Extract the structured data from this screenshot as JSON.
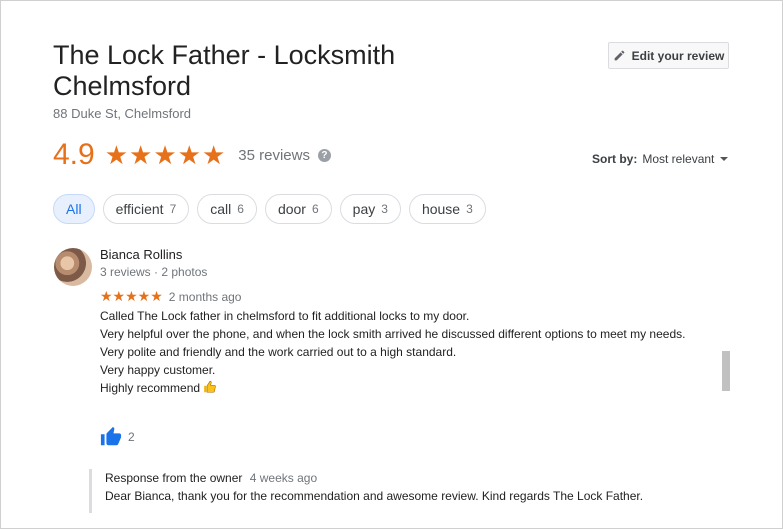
{
  "business": {
    "name": "The Lock Father - Locksmith Chelmsford",
    "address": "88 Duke St, Chelmsford",
    "rating": "4.9",
    "stars": "★★★★★",
    "review_count": "35 reviews",
    "help_icon": "?"
  },
  "toolbar": {
    "edit_review_label": "Edit your review",
    "sort_label": "Sort by:",
    "sort_value": "Most relevant"
  },
  "chips": [
    {
      "label": "All",
      "count": ""
    },
    {
      "label": "efficient",
      "count": "7"
    },
    {
      "label": "call",
      "count": "6"
    },
    {
      "label": "door",
      "count": "6"
    },
    {
      "label": "pay",
      "count": "3"
    },
    {
      "label": "house",
      "count": "3"
    }
  ],
  "review": {
    "author": "Bianca Rollins",
    "meta": "3 reviews · 2 photos",
    "stars": "★★★★★",
    "date": "2 months ago",
    "lines": [
      "Called The Lock father in chelmsford to fit additional locks to my door.",
      "Very helpful over the phone, and when the lock smith arrived he discussed different options to meet my needs.",
      "Very polite and friendly and the work carried out to a high standard.",
      "Very happy customer.",
      "Highly recommend"
    ],
    "likes": "2"
  },
  "response": {
    "title": "Response from the owner",
    "date": "4 weeks ago",
    "text": "Dear Bianca, thank you for the recommendation and awesome review. Kind regards The Lock Father."
  },
  "colors": {
    "accent_orange": "#e7711b",
    "chip_active_bg": "#e8f0fe",
    "like_blue": "#1a73e8"
  },
  "icons": {
    "edit": "pencil-icon",
    "help": "help-circle-icon",
    "sort": "caret-down-icon",
    "like": "thumbs-up-icon",
    "emoji": "thumbs-up-emoji-icon"
  }
}
